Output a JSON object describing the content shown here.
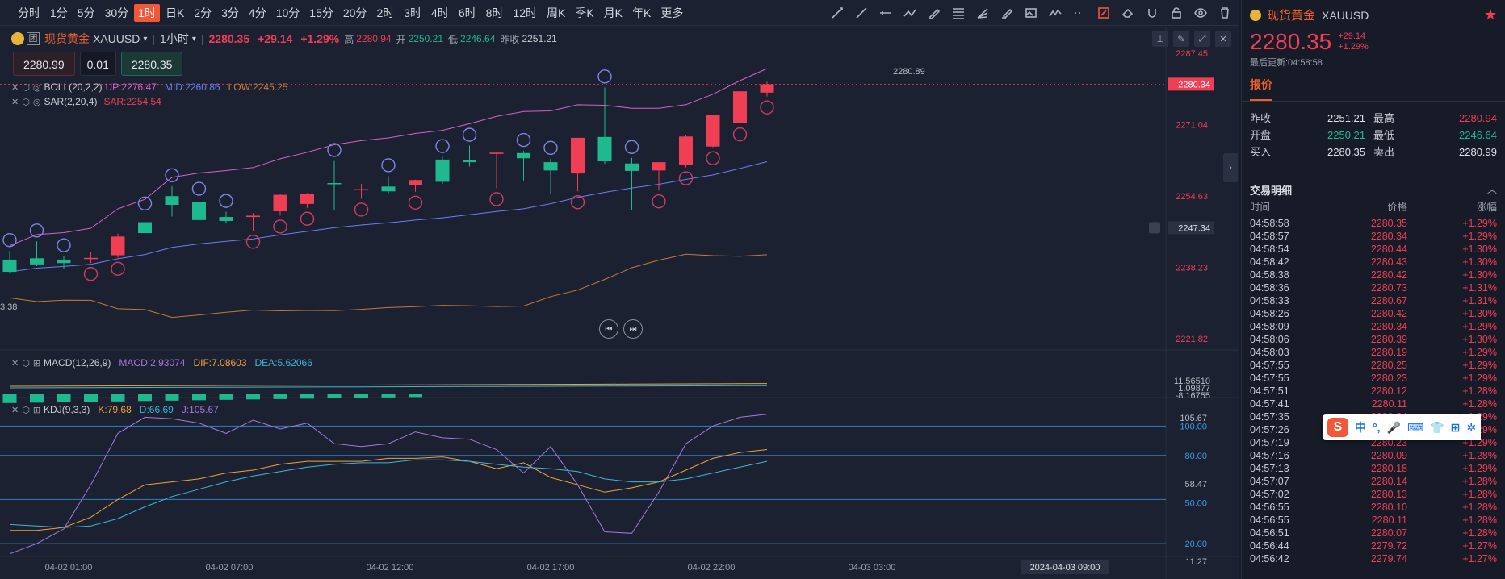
{
  "timeframes": [
    "分时",
    "1分",
    "5分",
    "30分",
    "1时",
    "日K",
    "2分",
    "3分",
    "4分",
    "10分",
    "15分",
    "20分",
    "2时",
    "3时",
    "4时",
    "6时",
    "8时",
    "12时",
    "周K",
    "季K",
    "月K",
    "年K",
    "更多"
  ],
  "active_timeframe": "1时",
  "symbol": {
    "name": "现货黄金",
    "code": "XAUUSD",
    "tag": "团",
    "period": "1小时",
    "price": "2280.35",
    "change": "+29.14",
    "change_pct": "+1.29%",
    "high_label": "高",
    "high": "2280.94",
    "open_label": "开",
    "open": "2250.21",
    "low_label": "低",
    "low": "2246.64",
    "prev_label": "昨收",
    "prev": "2251.21"
  },
  "order": {
    "sell_price": "2280.99",
    "qty": "0.01",
    "buy_price": "2280.35"
  },
  "indicators": {
    "boll": {
      "name": "BOLL(20,2,2)",
      "up": "UP:2276.47",
      "mid": "MID:2260.86",
      "low": "LOW:2245.25"
    },
    "sar": {
      "name": "SAR(2,20,4)",
      "val": "SAR:2254.54"
    },
    "macd": {
      "name": "MACD(12,26,9)",
      "macd": "MACD:2.93074",
      "dif": "DIF:7.08603",
      "dea": "DEA:5.62066"
    },
    "kdj": {
      "name": "KDJ(9,3,3)",
      "k": "K:79.68",
      "d": "D:66.69",
      "j": "J:105.67"
    }
  },
  "price_axis": {
    "labels": [
      "2287.45",
      "2271.04",
      "2254.63",
      "2238.23",
      "2221.82"
    ],
    "current": "2280.34",
    "crosshair": "2247.34",
    "max_marker": "2280.89",
    "min_marker": "3.38"
  },
  "macd_axis": [
    "11.56510",
    "1.09877",
    "-8.16755"
  ],
  "kdj_axis": [
    "105.67",
    "100.00",
    "80.00",
    "58.47",
    "50.00",
    "20.00",
    "11.27"
  ],
  "time_axis": [
    "04-02 01:00",
    "04-02 07:00",
    "04-02 12:00",
    "04-02 17:00",
    "04-02 22:00",
    "04-03 03:00"
  ],
  "time_cursor": "2024-04-03 09:00",
  "colors": {
    "up": "#f03e55",
    "down": "#1fb98f",
    "accent": "#f2573a"
  },
  "chart_data": {
    "type": "candlestick",
    "ylim": [
      2221.82,
      2287.45
    ],
    "candles": [
      {
        "o": 2240.0,
        "h": 2242.0,
        "l": 2236.8,
        "c": 2237.2
      },
      {
        "o": 2240.3,
        "h": 2244.2,
        "l": 2238.5,
        "c": 2238.9
      },
      {
        "o": 2240.0,
        "h": 2240.8,
        "l": 2237.8,
        "c": 2239.2
      },
      {
        "o": 2240.3,
        "h": 2241.8,
        "l": 2239.2,
        "c": 2240.4
      },
      {
        "o": 2241.0,
        "h": 2246.0,
        "l": 2240.4,
        "c": 2245.3
      },
      {
        "o": 2248.6,
        "h": 2250.4,
        "l": 2244.4,
        "c": 2246.1
      },
      {
        "o": 2254.6,
        "h": 2256.9,
        "l": 2249.9,
        "c": 2252.6
      },
      {
        "o": 2253.2,
        "h": 2253.8,
        "l": 2248.5,
        "c": 2249.1
      },
      {
        "o": 2249.8,
        "h": 2251.0,
        "l": 2248.3,
        "c": 2248.9
      },
      {
        "o": 2249.8,
        "h": 2250.7,
        "l": 2246.6,
        "c": 2250.1
      },
      {
        "o": 2251.1,
        "h": 2255.1,
        "l": 2250.1,
        "c": 2254.9
      },
      {
        "o": 2252.8,
        "h": 2255.3,
        "l": 2251.9,
        "c": 2255.2
      },
      {
        "o": 2257.6,
        "h": 2262.7,
        "l": 2251.5,
        "c": 2257.4
      },
      {
        "o": 2256.0,
        "h": 2257.4,
        "l": 2254.0,
        "c": 2256.2
      },
      {
        "o": 2256.8,
        "h": 2259.2,
        "l": 2255.3,
        "c": 2255.7
      },
      {
        "o": 2257.2,
        "h": 2258.4,
        "l": 2255.6,
        "c": 2258.3
      },
      {
        "o": 2263.0,
        "h": 2263.6,
        "l": 2257.4,
        "c": 2257.9
      },
      {
        "o": 2262.8,
        "h": 2266.2,
        "l": 2261.4,
        "c": 2262.4
      },
      {
        "o": 2264.3,
        "h": 2264.8,
        "l": 2256.4,
        "c": 2264.6
      },
      {
        "o": 2264.5,
        "h": 2265.0,
        "l": 2258.2,
        "c": 2263.3
      },
      {
        "o": 2262.4,
        "h": 2263.2,
        "l": 2255.0,
        "c": 2260.5
      },
      {
        "o": 2259.8,
        "h": 2268.0,
        "l": 2255.7,
        "c": 2268.0
      },
      {
        "o": 2268.2,
        "h": 2279.6,
        "l": 2262.0,
        "c": 2262.6
      },
      {
        "o": 2262.1,
        "h": 2263.4,
        "l": 2251.4,
        "c": 2260.4
      },
      {
        "o": 2260.5,
        "h": 2261.9,
        "l": 2255.9,
        "c": 2262.4
      },
      {
        "o": 2261.8,
        "h": 2268.6,
        "l": 2261.2,
        "c": 2268.3
      },
      {
        "o": 2266.0,
        "h": 2273.2,
        "l": 2265.8,
        "c": 2273.2
      },
      {
        "o": 2271.5,
        "h": 2279.0,
        "l": 2271.3,
        "c": 2278.7
      },
      {
        "o": 2278.4,
        "h": 2280.9,
        "l": 2277.5,
        "c": 2280.3
      }
    ]
  },
  "right_panel": {
    "title": "现货黄金",
    "code": "XAUUSD",
    "price": "2280.35",
    "change": "+29.14",
    "change_pct": "+1.29%",
    "updated": "最后更新:04:58:58",
    "quote_tab": "报价",
    "quote": [
      {
        "k1": "昨收",
        "v1": "2251.21",
        "k2": "最高",
        "v2": "2280.94"
      },
      {
        "k1": "开盘",
        "v1": "2250.21",
        "k2": "最低",
        "v2": "2246.64"
      },
      {
        "k1": "买入",
        "v1": "2280.35",
        "k2": "卖出",
        "v2": "2280.99"
      }
    ],
    "trades_title": "交易明细",
    "trade_headers": [
      "时间",
      "价格",
      "涨幅"
    ],
    "trades": [
      [
        "04:58:58",
        "2280.35",
        "+1.29%"
      ],
      [
        "04:58:57",
        "2280.34",
        "+1.29%"
      ],
      [
        "04:58:54",
        "2280.44",
        "+1.30%"
      ],
      [
        "04:58:42",
        "2280.43",
        "+1.30%"
      ],
      [
        "04:58:38",
        "2280.42",
        "+1.30%"
      ],
      [
        "04:58:36",
        "2280.73",
        "+1.31%"
      ],
      [
        "04:58:33",
        "2280.67",
        "+1.31%"
      ],
      [
        "04:58:26",
        "2280.42",
        "+1.30%"
      ],
      [
        "04:58:09",
        "2280.34",
        "+1.29%"
      ],
      [
        "04:58:06",
        "2280.39",
        "+1.30%"
      ],
      [
        "04:58:03",
        "2280.19",
        "+1.29%"
      ],
      [
        "04:57:55",
        "2280.25",
        "+1.29%"
      ],
      [
        "04:57:55",
        "2280.23",
        "+1.29%"
      ],
      [
        "04:57:51",
        "2280.12",
        "+1.28%"
      ],
      [
        "04:57:41",
        "2280.11",
        "+1.28%"
      ],
      [
        "04:57:35",
        "2280.24",
        "+1.29%"
      ],
      [
        "04:57:26",
        "2280.20",
        "+1.29%"
      ],
      [
        "04:57:19",
        "2280.23",
        "+1.29%"
      ],
      [
        "04:57:16",
        "2280.09",
        "+1.28%"
      ],
      [
        "04:57:13",
        "2280.18",
        "+1.29%"
      ],
      [
        "04:57:07",
        "2280.14",
        "+1.28%"
      ],
      [
        "04:57:02",
        "2280.13",
        "+1.28%"
      ],
      [
        "04:56:55",
        "2280.10",
        "+1.28%"
      ],
      [
        "04:56:55",
        "2280.11",
        "+1.28%"
      ],
      [
        "04:56:51",
        "2280.07",
        "+1.28%"
      ],
      [
        "04:56:44",
        "2279.72",
        "+1.27%"
      ],
      [
        "04:56:42",
        "2279.74",
        "+1.27%"
      ]
    ],
    "ime_chars": [
      "中",
      "°,",
      "🎤",
      "⌨",
      "👕",
      "⊞",
      "✲"
    ]
  }
}
